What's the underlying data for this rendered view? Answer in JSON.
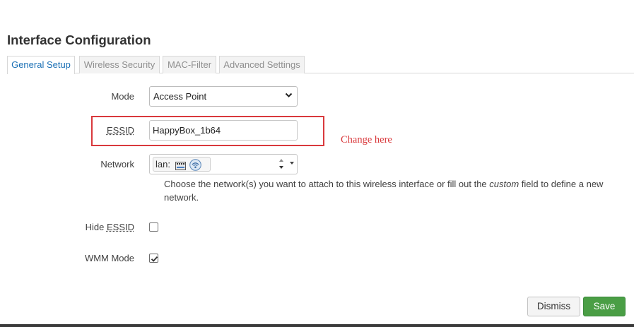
{
  "section": {
    "title": "Interface Configuration"
  },
  "tabs": [
    {
      "label": "General Setup",
      "active": true
    },
    {
      "label": "Wireless Security",
      "active": false
    },
    {
      "label": "MAC-Filter",
      "active": false
    },
    {
      "label": "Advanced Settings",
      "active": false
    }
  ],
  "form": {
    "mode": {
      "label": "Mode",
      "value": "Access Point"
    },
    "essid": {
      "label": "ESSID",
      "value": "HappyBox_1b64"
    },
    "network": {
      "label": "Network",
      "chip": "lan:",
      "icons": [
        "switch-icon",
        "wifi-icon"
      ],
      "help_before": "Choose the network(s) you want to attach to this wireless interface or fill out the ",
      "help_em": "custom",
      "help_after": " field to define a new network."
    },
    "hide_essid": {
      "label_prefix": "Hide ",
      "label_abbr": "ESSID",
      "checked": false
    },
    "wmm_mode": {
      "label": "WMM Mode",
      "checked": true
    }
  },
  "annotation": {
    "text": "Change here",
    "color": "#d9393c"
  },
  "buttons": {
    "dismiss": "Dismiss",
    "save": "Save"
  },
  "colors": {
    "accent_tab": "#1a6fb5",
    "save_green": "#4a9e45",
    "highlight_red": "#d9393c"
  }
}
